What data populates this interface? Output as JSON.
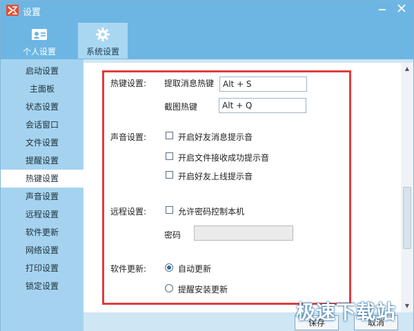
{
  "window": {
    "title": "设置"
  },
  "top_tabs": [
    {
      "label": "个人设置",
      "icon": "id-card-icon"
    },
    {
      "label": "系统设置",
      "icon": "gear-icon",
      "active": true
    }
  ],
  "sidebar": {
    "items": [
      {
        "label": "启动设置"
      },
      {
        "label": "主面板"
      },
      {
        "label": "状态设置"
      },
      {
        "label": "会话窗口"
      },
      {
        "label": "文件设置"
      },
      {
        "label": "提醒设置"
      },
      {
        "label": "热键设置",
        "active": true
      },
      {
        "label": "声音设置"
      },
      {
        "label": "远程设置"
      },
      {
        "label": "软件更新"
      },
      {
        "label": "网络设置"
      },
      {
        "label": "打印设置"
      },
      {
        "label": "锁定设置"
      }
    ]
  },
  "hotkey": {
    "section_label": "热键设置:",
    "extract_label": "提取消息热键",
    "extract_value": "Alt + S",
    "screenshot_label": "截图热键",
    "screenshot_value": "Alt + Q"
  },
  "sound": {
    "section_label": "声音设置:",
    "options": [
      {
        "label": "开启好友消息提示音",
        "checked": false
      },
      {
        "label": "开启文件接收成功提示音",
        "checked": false
      },
      {
        "label": "开启好友上线提示音",
        "checked": false
      }
    ]
  },
  "remote": {
    "section_label": "远程设置:",
    "allow_label": "允许密码控制本机",
    "allow_checked": false,
    "password_label": "密码",
    "password_value": ""
  },
  "update": {
    "section_label": "软件更新:",
    "options": [
      {
        "label": "自动更新",
        "selected": true
      },
      {
        "label": "提醒安装更新",
        "selected": false
      }
    ]
  },
  "footer": {
    "save_label": "保存",
    "cancel_label": "取消"
  },
  "watermark": "极速下载站",
  "colors": {
    "titlebar": "#6db6e3",
    "sidebar": "#a5d3ef",
    "highlight": "#e23b3b",
    "accent": "#1f6fb5"
  }
}
